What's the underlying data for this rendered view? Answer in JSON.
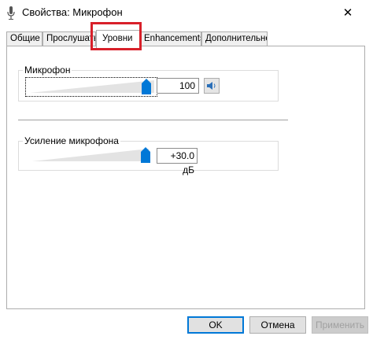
{
  "window": {
    "title": "Свойства: Микрофон",
    "close_glyph": "✕",
    "icon": "microphone-icon"
  },
  "tabs": [
    {
      "label": "Общие"
    },
    {
      "label": "Прослушать"
    },
    {
      "label": "Уровни",
      "active": true
    },
    {
      "label": "Enhancements"
    },
    {
      "label": "Дополнительно"
    }
  ],
  "levels": {
    "microphone": {
      "label": "Микрофон",
      "value": "100",
      "level_percent": 100,
      "mute_icon": "speaker-icon"
    },
    "boost": {
      "label": "Усиление микрофона",
      "value": "+30.0 дБ",
      "level_percent": 100
    }
  },
  "buttons": {
    "ok": "OK",
    "cancel": "Отмена",
    "apply": "Применить"
  },
  "colors": {
    "highlight": "#d8202a",
    "thumb": "#0078d7"
  }
}
